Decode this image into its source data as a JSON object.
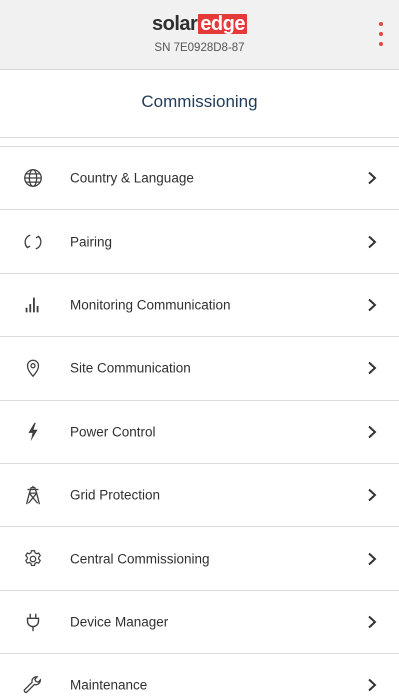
{
  "header": {
    "logo_part1": "solar",
    "logo_part2": "edge",
    "serial": "SN 7E0928D8-87",
    "menu_icon": "more-vert-icon"
  },
  "page": {
    "title": "Commissioning"
  },
  "menu": {
    "items": [
      {
        "label": "Country & Language",
        "icon": "globe-icon"
      },
      {
        "label": "Pairing",
        "icon": "sync-icon"
      },
      {
        "label": "Monitoring Communication",
        "icon": "bar-chart-icon"
      },
      {
        "label": "Site Communication",
        "icon": "location-pin-icon"
      },
      {
        "label": "Power Control",
        "icon": "lightning-icon"
      },
      {
        "label": "Grid Protection",
        "icon": "transmission-tower-icon"
      },
      {
        "label": "Central Commissioning",
        "icon": "gear-icon"
      },
      {
        "label": "Device Manager",
        "icon": "plug-icon"
      },
      {
        "label": "Maintenance",
        "icon": "wrench-icon"
      }
    ]
  },
  "colors": {
    "brand_red": "#e63a3a",
    "title_blue": "#1f3b5b",
    "header_bg": "#f1f1f1"
  }
}
